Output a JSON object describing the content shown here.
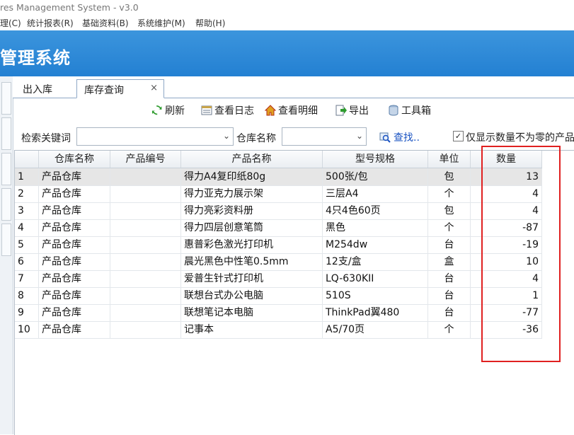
{
  "window": {
    "title": "res Management System - v3.0"
  },
  "menu": [
    "理(C)",
    "统计报表(R)",
    "基础资料(B)",
    "系统维护(M)",
    "帮助(H)"
  ],
  "banner": {
    "title": "管理系统"
  },
  "tabs": [
    {
      "label": "出入库",
      "active": false
    },
    {
      "label": "库存查询",
      "active": true,
      "close": "×"
    }
  ],
  "toolbar": {
    "refresh": "刷新",
    "view_log": "查看日志",
    "view_detail": "查看明细",
    "export": "导出",
    "toolbox": "工具箱"
  },
  "filter": {
    "keyword_label": "检索关键词",
    "keyword_value": "",
    "warehouse_label": "仓库名称",
    "warehouse_value": "",
    "find_label": "查找..",
    "nonzero_checked": true,
    "nonzero_label": "仅显示数量不为零的产品"
  },
  "table": {
    "columns": [
      "",
      "仓库名称",
      "产品编号",
      "产品名称",
      "型号规格",
      "单位",
      "数量"
    ],
    "rows": [
      [
        "1",
        "产品仓库",
        "",
        "得力A4复印纸80g",
        "500张/包",
        "包",
        "13"
      ],
      [
        "2",
        "产品仓库",
        "",
        "得力亚克力展示架",
        "三层A4",
        "个",
        "4"
      ],
      [
        "3",
        "产品仓库",
        "",
        "得力亮彩资料册",
        "4只4色60页",
        "包",
        "4"
      ],
      [
        "4",
        "产品仓库",
        "",
        "得力四层创意笔筒",
        "黑色",
        "个",
        "-87"
      ],
      [
        "5",
        "产品仓库",
        "",
        "惠普彩色激光打印机",
        "M254dw",
        "台",
        "-19"
      ],
      [
        "6",
        "产品仓库",
        "",
        "晨光黑色中性笔0.5mm",
        "12支/盒",
        "盒",
        "10"
      ],
      [
        "7",
        "产品仓库",
        "",
        "爱普生针式打印机",
        "LQ-630KII",
        "台",
        "4"
      ],
      [
        "8",
        "产品仓库",
        "",
        "联想台式办公电脑",
        "510S",
        "台",
        "1"
      ],
      [
        "9",
        "产品仓库",
        "",
        "联想笔记本电脑",
        "ThinkPad翼480",
        "台",
        "-77"
      ],
      [
        "10",
        "产品仓库",
        "",
        "记事本",
        "A5/70页",
        "个",
        "-36"
      ]
    ]
  },
  "colors": {
    "banner": "#2a86d6",
    "highlight_box": "#e02020",
    "selected_row": "#e6e6e6"
  }
}
